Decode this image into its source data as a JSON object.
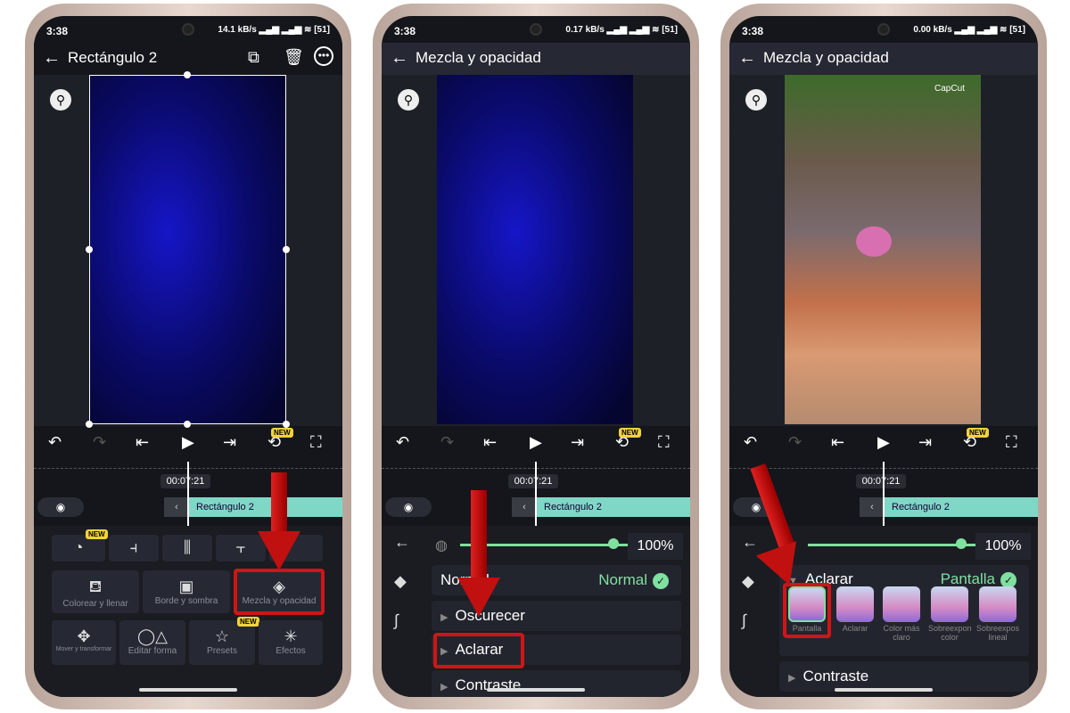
{
  "status": {
    "time": "3:38",
    "speeds": [
      "14.1 kB/s",
      "0.17 kB/s",
      "0.00 kB/s"
    ],
    "battery": "51"
  },
  "phone1": {
    "title": "Rectángulo 2",
    "timecode": "00:07:21",
    "clip": "Rectángulo 2",
    "new_badge": "NEW",
    "tools": [
      "Colorear y llenar",
      "Borde y sombra",
      "Mezcla y opacidad",
      "Mover y transformar",
      "Editar forma",
      "Presets",
      "Efectos"
    ]
  },
  "phone2": {
    "title": "Mezcla y opacidad",
    "timecode": "00:07:21",
    "clip": "Rectángulo 2",
    "new_badge": "NEW",
    "opacity": "100%",
    "normal_label": "Normal",
    "normal_value": "Normal",
    "groups": [
      "Oscurecer",
      "Aclarar",
      "Contraste"
    ]
  },
  "phone3": {
    "title": "Mezcla y opacidad",
    "timecode": "00:07:21",
    "clip": "Rectángulo 2",
    "new_badge": "NEW",
    "opacity": "100%",
    "group": "Aclarar",
    "selected": "Pantalla",
    "modes": [
      "Pantalla",
      "Aclarar",
      "Color más claro",
      "Sobreexponer color",
      "Sobreexposición lineal"
    ],
    "next_group": "Contraste",
    "watermark": "CapCut"
  },
  "colors": {
    "accent": "#7fe0a0",
    "clip": "#7fd7c6",
    "highlight": "#d01515",
    "badge": "#f3d23c"
  }
}
